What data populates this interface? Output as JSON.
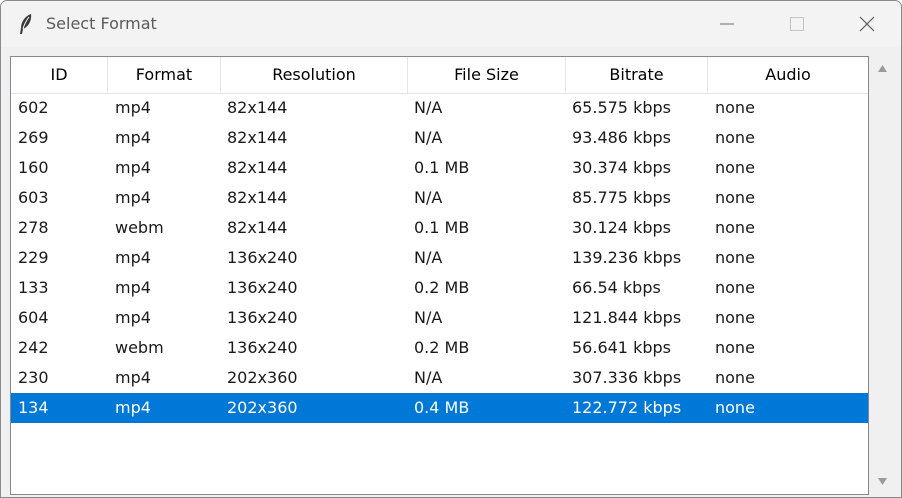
{
  "window": {
    "title": "Select Format",
    "icon": "feather-icon",
    "controls": [
      "minimize-icon",
      "maximize-icon",
      "close-icon"
    ]
  },
  "table": {
    "columns": [
      "ID",
      "Format",
      "Resolution",
      "File Size",
      "Bitrate",
      "Audio"
    ],
    "rows": [
      [
        "602",
        "mp4",
        "82x144",
        "N/A",
        "65.575 kbps",
        "none"
      ],
      [
        "269",
        "mp4",
        "82x144",
        "N/A",
        "93.486 kbps",
        "none"
      ],
      [
        "160",
        "mp4",
        "82x144",
        "0.1 MB",
        "30.374 kbps",
        "none"
      ],
      [
        "603",
        "mp4",
        "82x144",
        "N/A",
        "85.775 kbps",
        "none"
      ],
      [
        "278",
        "webm",
        "82x144",
        "0.1 MB",
        "30.124 kbps",
        "none"
      ],
      [
        "229",
        "mp4",
        "136x240",
        "N/A",
        "139.236 kbps",
        "none"
      ],
      [
        "133",
        "mp4",
        "136x240",
        "0.2 MB",
        "66.54 kbps",
        "none"
      ],
      [
        "604",
        "mp4",
        "136x240",
        "N/A",
        "121.844 kbps",
        "none"
      ],
      [
        "242",
        "webm",
        "136x240",
        "0.2 MB",
        "56.641 kbps",
        "none"
      ],
      [
        "230",
        "mp4",
        "202x360",
        "N/A",
        "307.336 kbps",
        "none"
      ],
      [
        "134",
        "mp4",
        "202x360",
        "0.4 MB",
        "122.772 kbps",
        "none"
      ]
    ],
    "selected_row_index": 10
  },
  "colors": {
    "selection": "#0078d7",
    "selection_text": "#ffffff",
    "titlebar": "#f3f3f3",
    "background": "#f0f0f0"
  }
}
